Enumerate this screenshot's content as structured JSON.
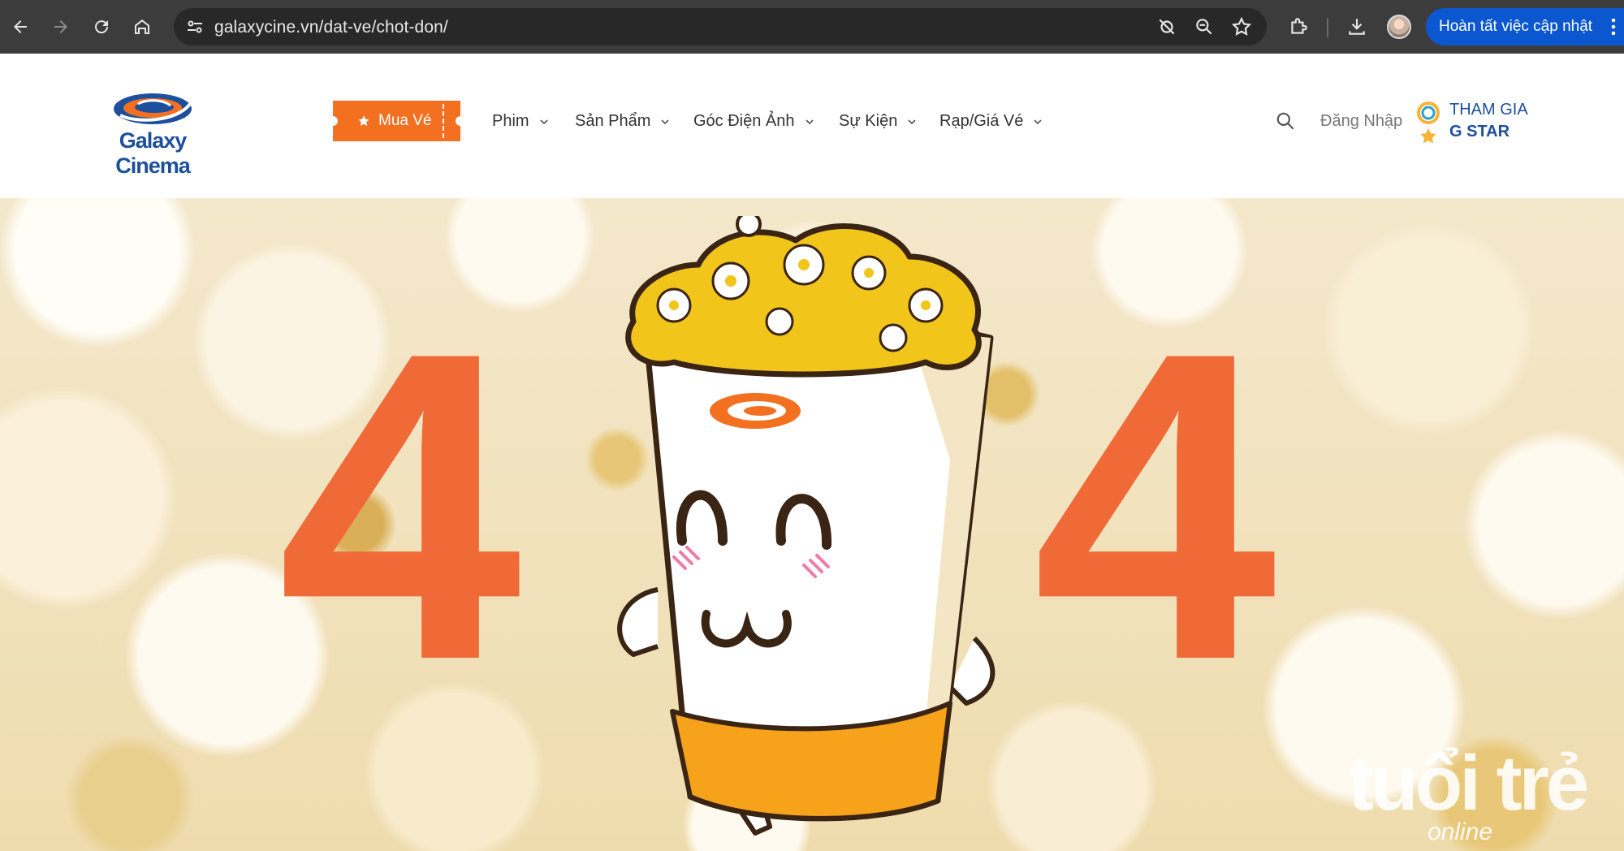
{
  "browser": {
    "url": "galaxycine.vn/dat-ve/chot-don/",
    "update_button": "Hoàn tất việc cập nhật"
  },
  "site": {
    "logo_text": "Galaxy Cinema",
    "buy_button": "Mua Vé",
    "nav": [
      "Phim",
      "Sản Phẩm",
      "Góc Điện Ảnh",
      "Sự Kiện",
      "Rạp/Giá Vé"
    ],
    "login": "Đăng Nhập",
    "gstar_line1": "THAM GIA",
    "gstar_line2": "G STAR"
  },
  "hero": {
    "digit_left": "4",
    "digit_right": "4"
  },
  "watermark": {
    "main": "tuổi trẻ",
    "sub": "online"
  },
  "colors": {
    "accent_orange": "#f37021",
    "brand_blue": "#1c4f9c",
    "digit_orange": "#f06a37",
    "chrome_dark": "#3c3c3c",
    "update_blue": "#0b57d0"
  }
}
